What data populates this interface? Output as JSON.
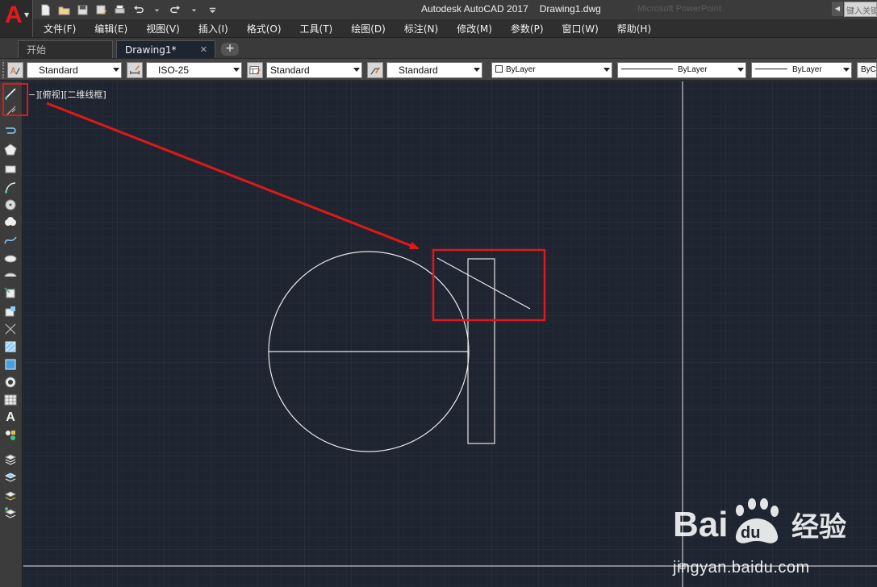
{
  "window": {
    "app_name": "Autodesk AutoCAD 2017",
    "file_name": "Drawing1.dwg",
    "ghost_title": "Microsoft PowerPoint",
    "search_placeholder": "键入关键字"
  },
  "app_logo": {
    "letter": "A"
  },
  "menu": {
    "items": [
      "文件(F)",
      "编辑(E)",
      "视图(V)",
      "插入(I)",
      "格式(O)",
      "工具(T)",
      "绘图(D)",
      "标注(N)",
      "修改(M)",
      "参数(P)",
      "窗口(W)",
      "帮助(H)"
    ]
  },
  "tabs": {
    "start_label": "开始",
    "active_label": "Drawing1*",
    "close_glyph": "✕",
    "add_glyph": "+"
  },
  "properties": {
    "text_style": "Standard",
    "dim_style": "ISO-25",
    "table_style": "Standard",
    "mleader_style": "Standard",
    "color": "ByLayer",
    "linetype": "ByLayer",
    "lineweight": "ByLayer",
    "plot_style": "ByC"
  },
  "viewport": {
    "label": "−][俯视][二维线框]"
  },
  "draw_toolbar": {
    "text_tool_glyph": "A"
  },
  "watermark": {
    "brand": "Bai du 经验",
    "url": "jingyan.baidu.com"
  },
  "colors": {
    "canvas_bg": "#1e2430",
    "grid_minor": "#262d39",
    "grid_major": "#2f3746",
    "geometry": "#e6e6e6",
    "highlight": "#e01818",
    "autocad_red": "#e21b1b"
  }
}
